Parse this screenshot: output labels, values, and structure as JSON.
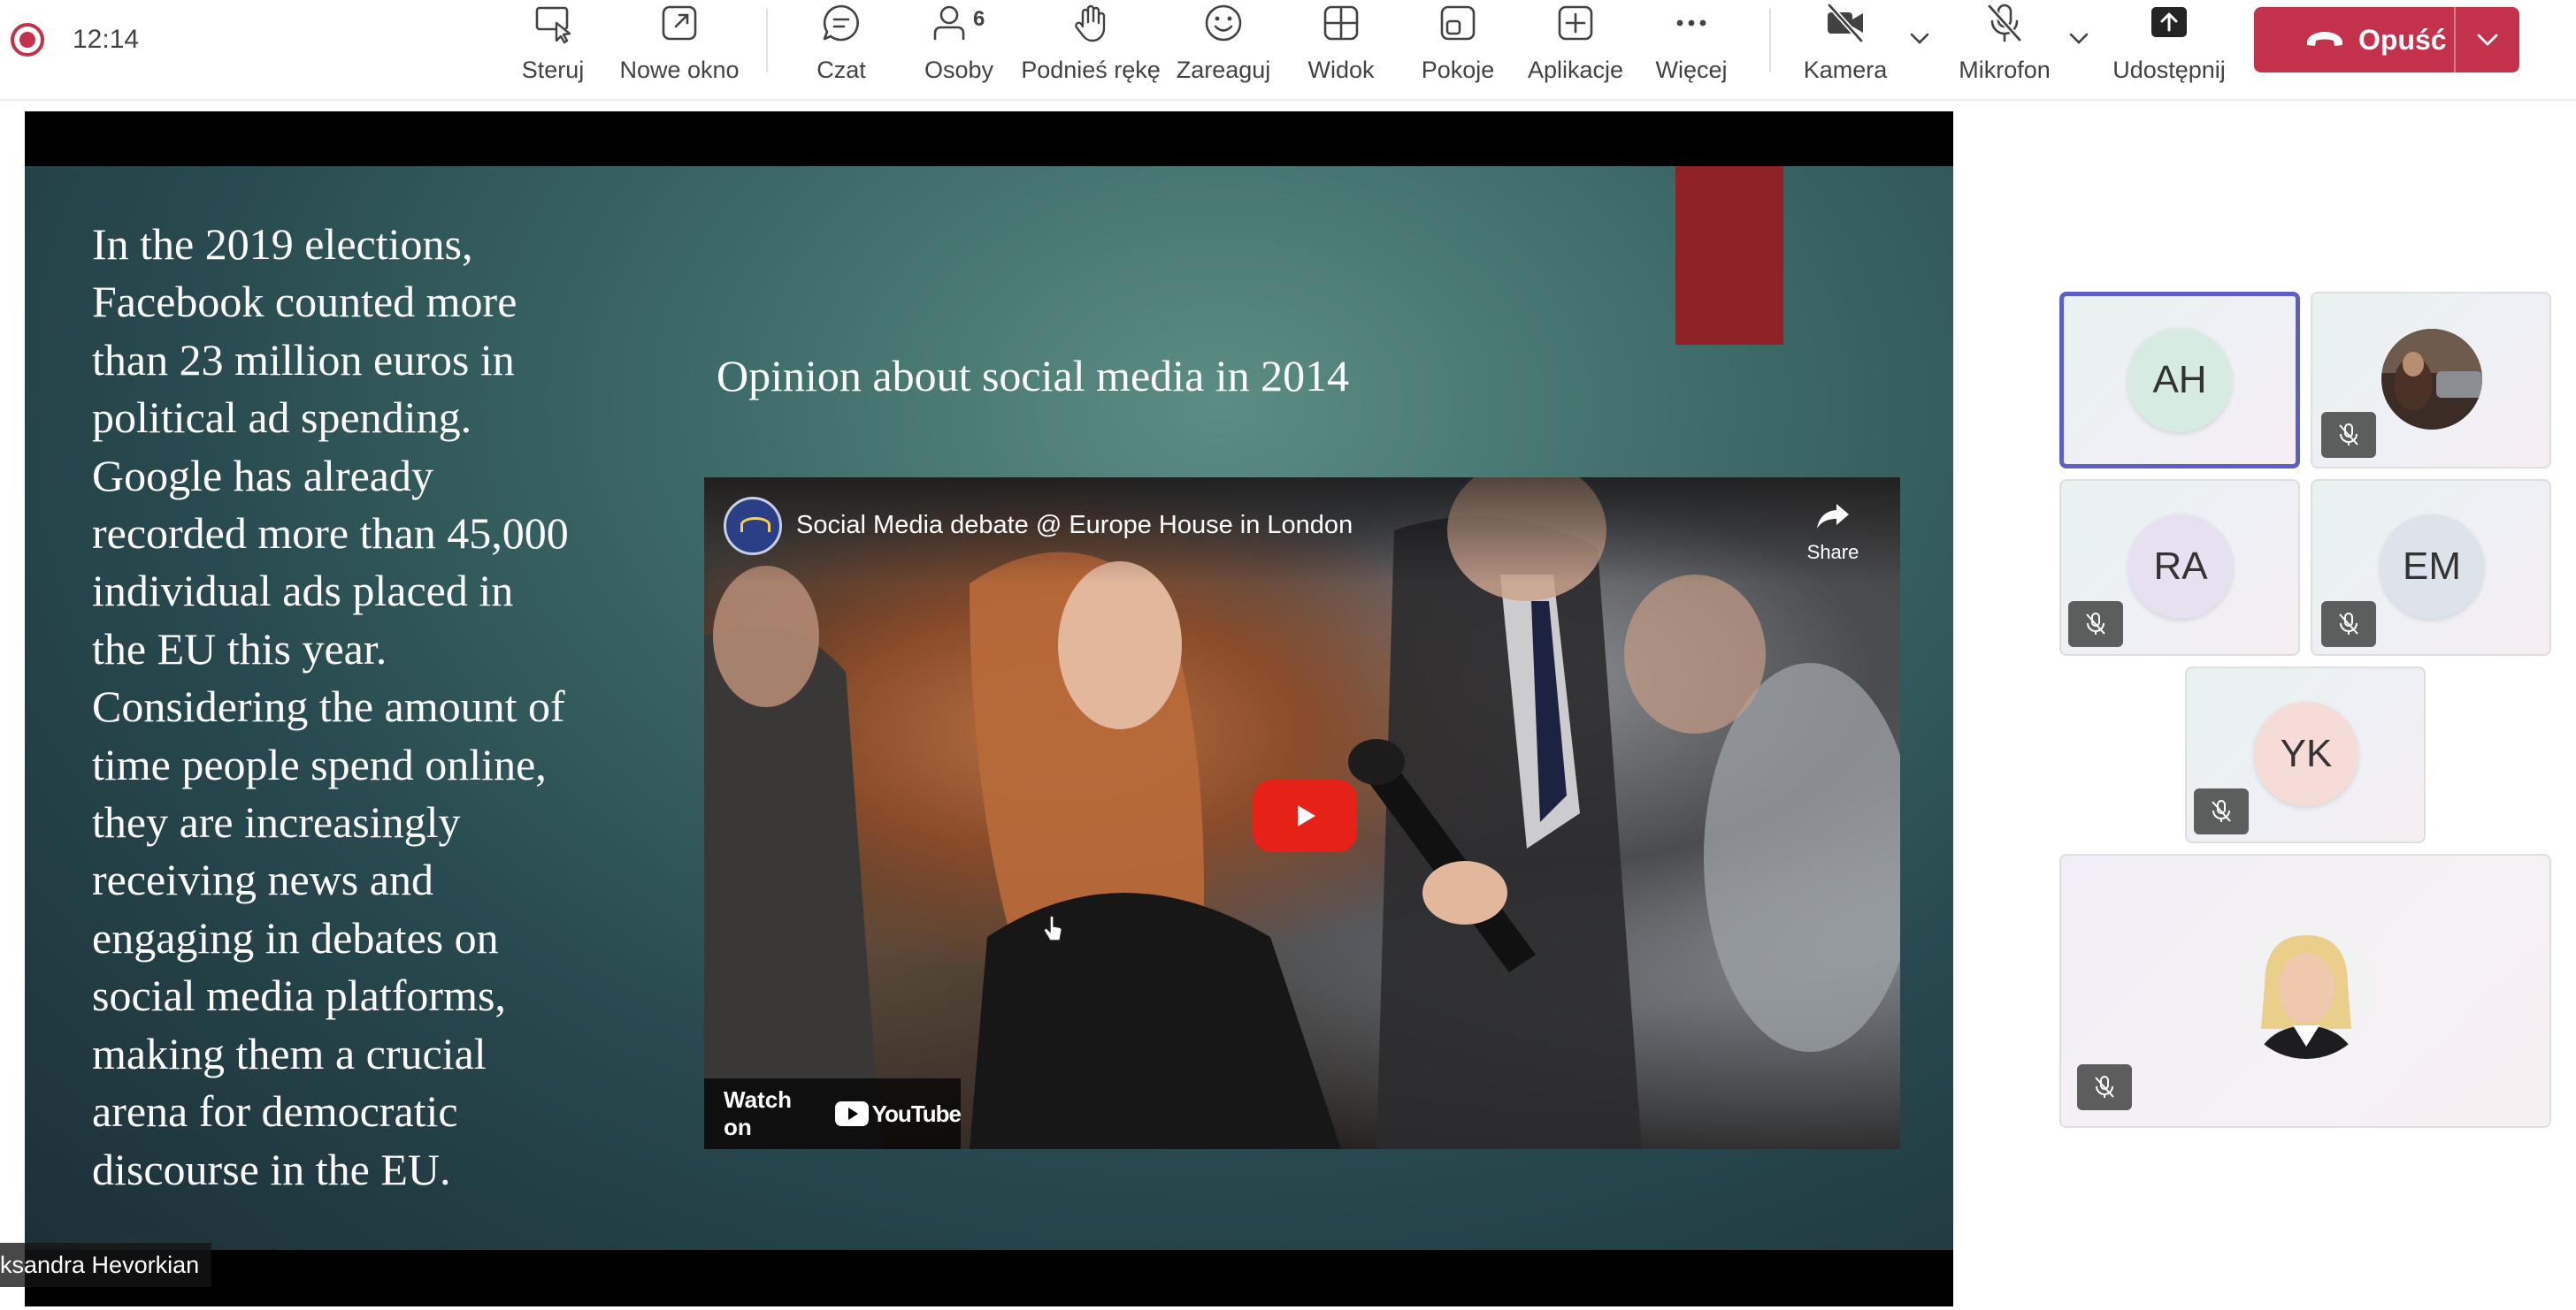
{
  "status": {
    "clock": "12:14"
  },
  "toolbar": {
    "steruj": "Steruj",
    "nowe_okno": "Nowe okno",
    "czat": "Czat",
    "osoby": "Osoby",
    "osoby_count": "6",
    "podnies_reke": "Podnieś rękę",
    "zareaguj": "Zareaguj",
    "widok": "Widok",
    "pokoje": "Pokoje",
    "aplikacje": "Aplikacje",
    "wiecej": "Więcej",
    "kamera": "Kamera",
    "mikrofon": "Mikrofon",
    "udostepnij": "Udostępnij",
    "leave": "Opuść",
    "leave_color": "#c4314b"
  },
  "slide": {
    "body_lines": [
      "In the 2019 elections,",
      "Facebook counted more",
      "than 23 million euros in",
      "political ad spending.",
      "Google has already",
      "recorded more than 45,000",
      "individual ads placed in",
      "the EU this year.",
      "Considering the amount of",
      "time people spend online,",
      "they are increasingly",
      "receiving news and",
      "engaging in debates on",
      "social media platforms,",
      "making them a crucial",
      "arena for democratic",
      "discourse in the EU."
    ],
    "title": "Opinion about social media in 2014",
    "accent_color": "#8e2226"
  },
  "video": {
    "title": "Social Media debate @ Europe House in London",
    "share": "Share",
    "watch_on": "Watch on",
    "youtube": "YouTube"
  },
  "presenter": {
    "name": "ksandra Hevorkian"
  },
  "participants": [
    {
      "initials": "AH",
      "active": true,
      "muted": false,
      "avatar_color": "#d6ece2"
    },
    {
      "initials": "",
      "photo": true,
      "muted": true
    },
    {
      "initials": "RA",
      "muted": true,
      "avatar_color": "#e6e0f0"
    },
    {
      "initials": "EM",
      "muted": true,
      "avatar_color": "#dde3ea"
    },
    {
      "initials": "YK",
      "muted": true,
      "avatar_color": "#f6dcd6"
    },
    {
      "initials": "",
      "photo": true,
      "muted": true
    }
  ]
}
